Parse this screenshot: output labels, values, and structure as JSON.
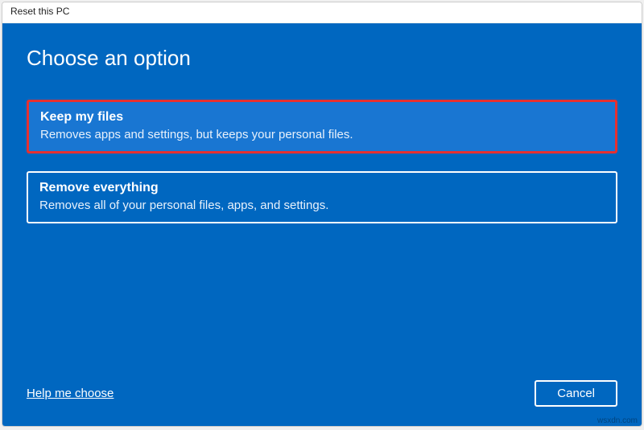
{
  "window": {
    "title": "Reset this PC"
  },
  "heading": "Choose an option",
  "options": [
    {
      "title": "Keep my files",
      "desc": "Removes apps and settings, but keeps your personal files."
    },
    {
      "title": "Remove everything",
      "desc": "Removes all of your personal files, apps, and settings."
    }
  ],
  "footer": {
    "help": "Help me choose",
    "cancel": "Cancel"
  },
  "watermark": "wsxdn.com"
}
